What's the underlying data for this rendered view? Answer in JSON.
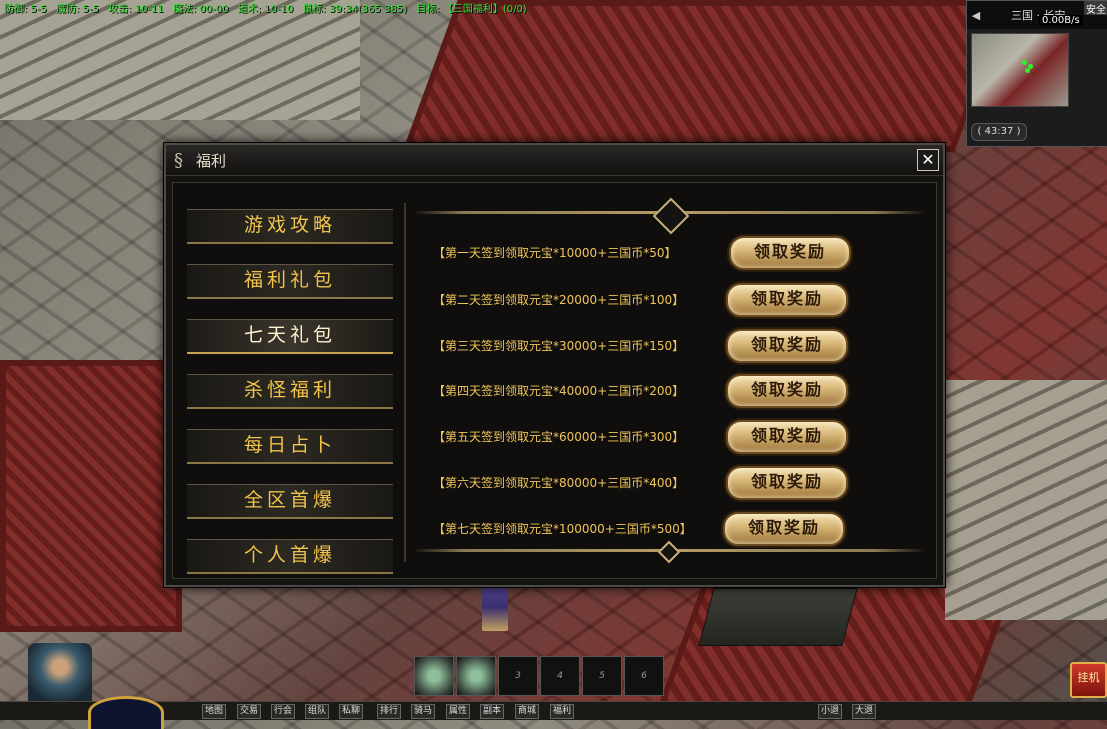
{
  "status": {
    "items": [
      "防御: 5-5",
      "魔防: 5-5",
      "攻击: 10-11",
      "魔法: 00-00",
      "道术: 10-10",
      "鼠标: 39:34(365 385)",
      "目标: 【三国福利】(0/0)"
    ]
  },
  "minimap": {
    "area": "三国 · 长安",
    "speed": "0.00B/s",
    "safe": "安全",
    "coords": "( 43:37 )"
  },
  "dialog": {
    "title": "福利",
    "close": "✕"
  },
  "menu": [
    "游戏攻略",
    "福利礼包",
    "七天礼包",
    "杀怪福利",
    "每日占卜",
    "全区首爆",
    "个人首爆"
  ],
  "rewards": [
    {
      "text": "【第一天签到领取元宝*10000+三国币*50】",
      "button": "领取奖励"
    },
    {
      "text": "【第二天签到领取元宝*20000+三国币*100】",
      "button": "领取奖励"
    },
    {
      "text": "【第三天签到领取元宝*30000+三国币*150】",
      "button": "领取奖励"
    },
    {
      "text": "【第四天签到领取元宝*40000+三国币*200】",
      "button": "领取奖励"
    },
    {
      "text": "【第五天签到领取元宝*60000+三国币*300】",
      "button": "领取奖励"
    },
    {
      "text": "【第六天签到领取元宝*80000+三国币*400】",
      "button": "领取奖励"
    },
    {
      "text": "【第七天签到领取元宝*100000+三国币*500】",
      "button": "领取奖励"
    }
  ],
  "hotbar": [
    "",
    "",
    "3",
    "4",
    "5",
    "6"
  ],
  "bottom_buttons": [
    "地图",
    "交易",
    "行会",
    "组队",
    "私聊",
    "排行",
    "骑马",
    "属性",
    "副本",
    "商城",
    "福利"
  ],
  "bottom_right": [
    "小退",
    "大退"
  ],
  "auto_fight": "挂机"
}
